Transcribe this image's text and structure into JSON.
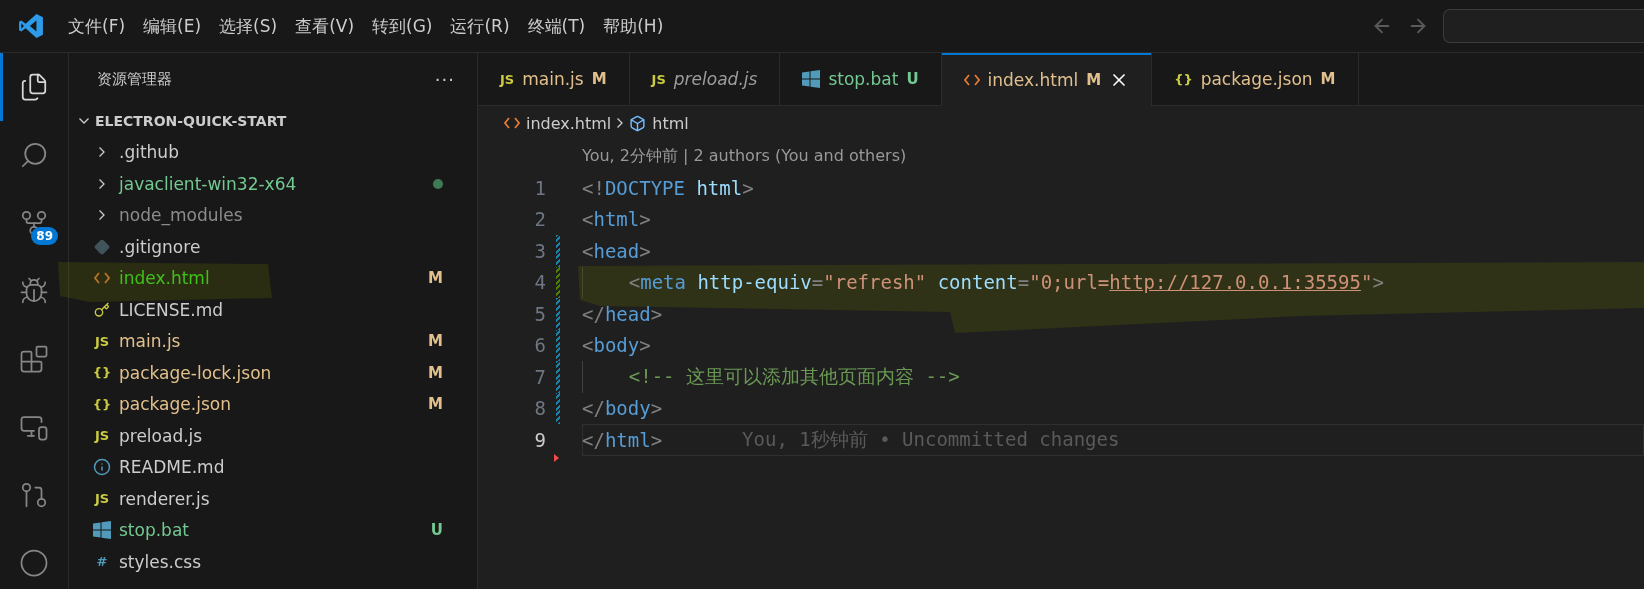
{
  "menu": [
    "文件(F)",
    "编辑(E)",
    "选择(S)",
    "查看(V)",
    "转到(G)",
    "运行(R)",
    "终端(T)",
    "帮助(H)"
  ],
  "activity_bar": [
    {
      "kind": "explorer",
      "selected": true
    },
    {
      "kind": "search",
      "selected": false
    },
    {
      "kind": "source-control",
      "selected": false,
      "badge": "89"
    },
    {
      "kind": "run-debug",
      "selected": false
    },
    {
      "kind": "extensions",
      "selected": false
    },
    {
      "kind": "remote",
      "selected": false
    },
    {
      "kind": "git-graph",
      "selected": false
    },
    {
      "kind": "partial",
      "selected": false
    }
  ],
  "sidebar": {
    "title": "资源管理器",
    "more": "···",
    "tree": {
      "label": "ELECTRON-QUICK-START",
      "expanded": true,
      "children": [
        {
          "label": ".github",
          "kind": "folder",
          "expanded": false,
          "color": "#cccccc"
        },
        {
          "label": "javaclient-win32-x64",
          "kind": "folder",
          "expanded": false,
          "color": "#73c991",
          "dot": true
        },
        {
          "label": "node_modules",
          "kind": "folder",
          "expanded": false,
          "color": "#8c8c8c"
        },
        {
          "label": ".gitignore",
          "kind": "git",
          "color": "#cccccc"
        },
        {
          "label": "index.html",
          "kind": "html",
          "color": "#3fc01a",
          "decoration": "M"
        },
        {
          "label": "LICENSE.md",
          "kind": "license",
          "color": "#cccccc"
        },
        {
          "label": "main.js",
          "kind": "glyph",
          "glyph": "JS",
          "color": "#e2c08d",
          "decoration": "M"
        },
        {
          "label": "package-lock.json",
          "kind": "glyph",
          "glyph": "{}",
          "color": "#e2c08d",
          "decoration": "M"
        },
        {
          "label": "package.json",
          "kind": "glyph",
          "glyph": "{}",
          "color": "#e2c08d",
          "decoration": "M"
        },
        {
          "label": "preload.js",
          "kind": "glyph",
          "glyph": "JS",
          "color": "#cccccc"
        },
        {
          "label": "README.md",
          "kind": "info",
          "color": "#cccccc"
        },
        {
          "label": "renderer.js",
          "kind": "glyph",
          "glyph": "JS",
          "color": "#cccccc"
        },
        {
          "label": "stop.bat",
          "kind": "windows",
          "color": "#73c991",
          "decoration": "U"
        },
        {
          "label": "styles.css",
          "kind": "glyph",
          "glyph": "#",
          "color": "#cccccc"
        }
      ]
    }
  },
  "tabs": [
    {
      "label": "main.js",
      "kind": "glyph",
      "glyph": "JS",
      "badge": "M",
      "color": "#e2c08d",
      "preview": false,
      "selected": false
    },
    {
      "label": "preload.js",
      "kind": "glyph",
      "glyph": "JS",
      "preview": true,
      "color": "#9d9d9d",
      "selected": false
    },
    {
      "label": "stop.bat",
      "kind": "windows",
      "badge": "U",
      "color": "#73c991",
      "preview": false,
      "selected": false
    },
    {
      "label": "index.html",
      "kind": "html",
      "badge": "M",
      "color": "#e2c08d",
      "preview": false,
      "selected": true
    },
    {
      "label": "package.json",
      "kind": "glyph",
      "glyph": "{}",
      "badge": "M",
      "color": "#e2c08d",
      "preview": false,
      "selected": false
    }
  ],
  "breadcrumb": [
    {
      "label": "index.html",
      "kind": "html"
    },
    {
      "label": "html",
      "kind": "element"
    }
  ],
  "codelens": "You, 2分钟前 | 2 authors (You and others)",
  "lines": [
    {
      "number": "1",
      "kind": "plain",
      "selected": false,
      "tokens": [
        {
          "kind": "punct",
          "text": "<!"
        },
        {
          "kind": "keyword",
          "text": "DOCTYPE"
        },
        {
          "kind": "attr",
          "text": " html"
        },
        {
          "kind": "punct",
          "text": ">"
        }
      ]
    },
    {
      "number": "2",
      "kind": "plain",
      "selected": false,
      "tokens": [
        {
          "kind": "punct",
          "text": "<"
        },
        {
          "kind": "tag",
          "text": "html"
        },
        {
          "kind": "punct",
          "text": ">"
        }
      ]
    },
    {
      "number": "3",
      "kind": "modified",
      "selected": false,
      "tokens": [
        {
          "kind": "punct",
          "text": "<"
        },
        {
          "kind": "tag",
          "text": "head"
        },
        {
          "kind": "punct",
          "text": ">"
        }
      ]
    },
    {
      "number": "4",
      "kind": "added",
      "selected": false,
      "indent": true,
      "tokens": [
        {
          "kind": "punct",
          "text": "<"
        },
        {
          "kind": "tag",
          "text": "meta"
        },
        {
          "kind": "attr",
          "text": " http-equiv"
        },
        {
          "kind": "punct",
          "text": "="
        },
        {
          "kind": "string",
          "text": "\"refresh\""
        },
        {
          "kind": "attr",
          "text": " content"
        },
        {
          "kind": "punct",
          "text": "="
        },
        {
          "kind": "string",
          "text": "\"0;url="
        },
        {
          "kind": "link",
          "text": "http://127.0.0.1:35595"
        },
        {
          "kind": "string",
          "text": "\""
        },
        {
          "kind": "punct",
          "text": ">"
        }
      ]
    },
    {
      "number": "5",
      "kind": "modified",
      "selected": false,
      "tokens": [
        {
          "kind": "punct",
          "text": "</"
        },
        {
          "kind": "tag",
          "text": "head"
        },
        {
          "kind": "punct",
          "text": ">"
        }
      ]
    },
    {
      "number": "6",
      "kind": "modified",
      "selected": false,
      "tokens": [
        {
          "kind": "punct",
          "text": "<"
        },
        {
          "kind": "tag",
          "text": "body"
        },
        {
          "kind": "punct",
          "text": ">"
        }
      ]
    },
    {
      "number": "7",
      "kind": "modified",
      "selected": false,
      "indent": true,
      "tokens": [
        {
          "kind": "comment",
          "text": "<!-- 这里可以添加其他页面内容 -->"
        }
      ]
    },
    {
      "number": "8",
      "kind": "modified",
      "selected": false,
      "tokens": [
        {
          "kind": "punct",
          "text": "</"
        },
        {
          "kind": "tag",
          "text": "body"
        },
        {
          "kind": "punct",
          "text": ">"
        }
      ]
    },
    {
      "number": "9",
      "kind": "deleted",
      "selected": true,
      "blame": "You, 1秒钟前 • Uncommitted changes",
      "tokens": [
        {
          "kind": "punct",
          "text": "</"
        },
        {
          "kind": "tag",
          "text": "html"
        },
        {
          "kind": "punct",
          "text": ">"
        }
      ]
    }
  ]
}
